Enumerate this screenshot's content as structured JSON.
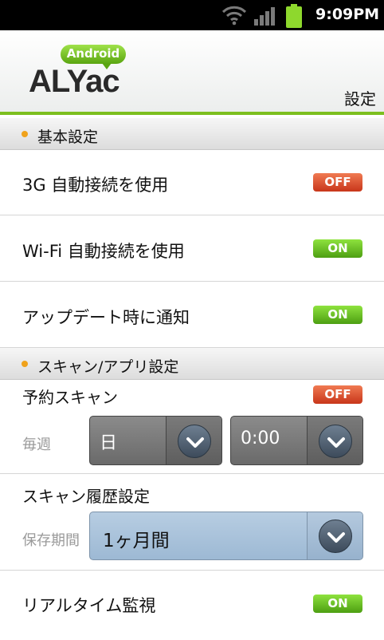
{
  "status_bar": {
    "time": "9:09PM"
  },
  "header": {
    "logo_badge": "Android",
    "logo_text": "ALYac",
    "title": "設定"
  },
  "sections": {
    "basic": "基本設定",
    "scan": "スキャン/アプリ設定"
  },
  "basic_settings": {
    "auto_3g": {
      "label": "3G 自動接続を使用",
      "state": "OFF"
    },
    "auto_wifi": {
      "label": "Wi-Fi 自動接続を使用",
      "state": "ON"
    },
    "update_notify": {
      "label": "アップデート時に通知",
      "state": "ON"
    }
  },
  "scan_settings": {
    "scheduled_scan": {
      "label": "予約スキャン",
      "state": "OFF",
      "frequency_label": "毎週",
      "day_value": "日",
      "time_value": "0:00"
    },
    "scan_history": {
      "label": "スキャン履歴設定",
      "retention_label": "保存期間",
      "retention_value": "1ヶ月間"
    },
    "realtime": {
      "label": "リアルタイム監視",
      "state": "ON"
    }
  },
  "colors": {
    "accent_green": "#7cbf1f",
    "toggle_on": "#5fb21a",
    "toggle_off": "#d84a25",
    "section_dot": "#f0a21b"
  },
  "icons": [
    "wifi-icon",
    "signal-icon",
    "battery-icon",
    "chevron-down-icon"
  ]
}
